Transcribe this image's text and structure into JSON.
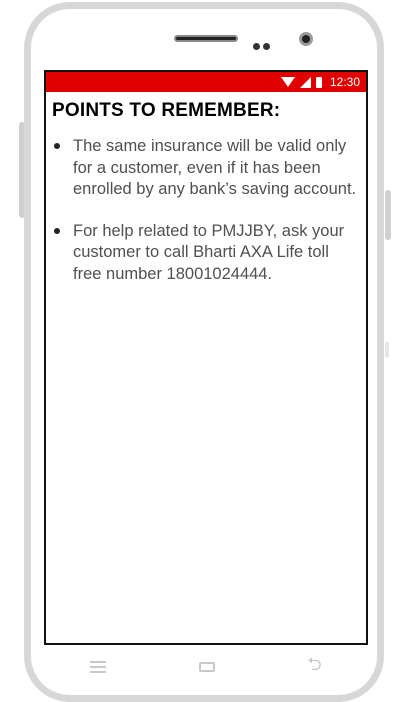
{
  "status_bar": {
    "time": "12:30",
    "icons": [
      "wifi-icon",
      "signal-icon",
      "battery-icon"
    ],
    "color": "#e00000"
  },
  "page": {
    "title": "POINTS TO REMEMBER:",
    "points": [
      "The same insurance will be valid only for a customer, even if it has been enrolled by any bank’s saving account.",
      "For help related to PMJJBY, ask your customer to call Bharti AXA Life toll free number 18001024444."
    ]
  },
  "nav_bar": {
    "buttons": [
      "menu-icon",
      "home-icon",
      "back-icon"
    ],
    "back_glyph": "⮌"
  }
}
